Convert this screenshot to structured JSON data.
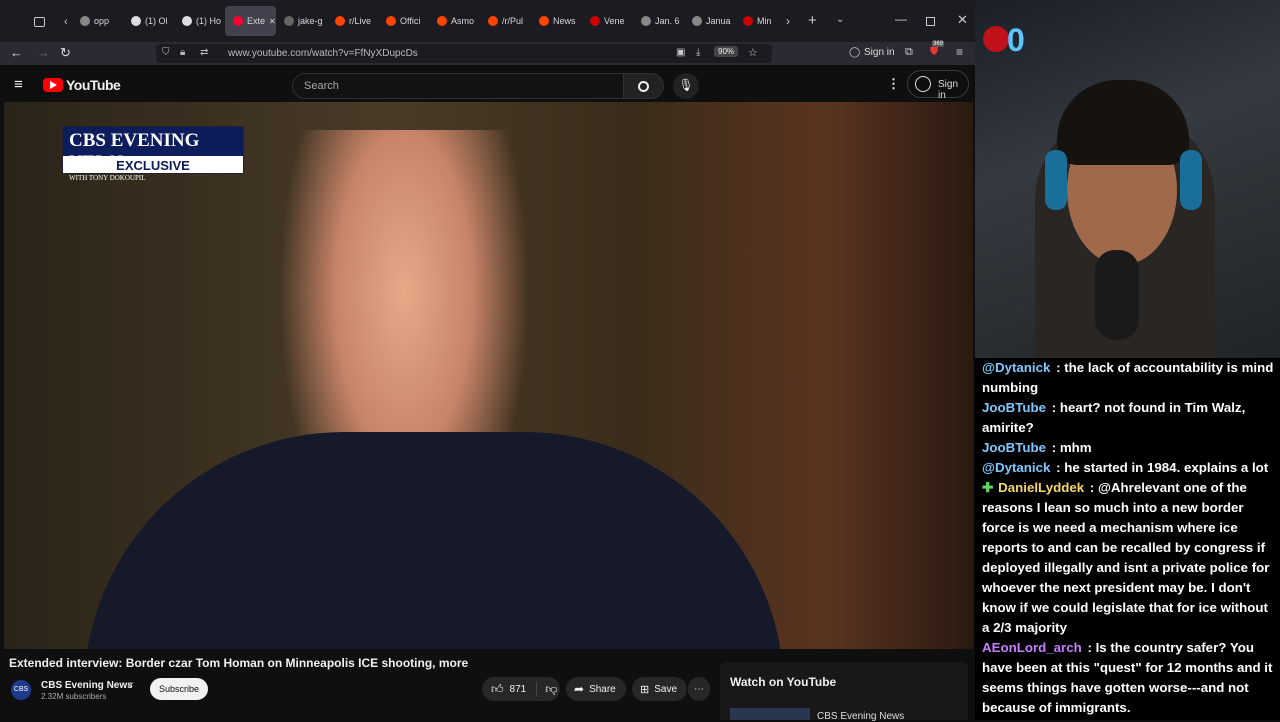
{
  "browser": {
    "tabs": [
      {
        "label": "opp",
        "color": "#888"
      },
      {
        "label": "(1) Ol",
        "color": "#ddd"
      },
      {
        "label": "(1) Ho",
        "color": "#ddd"
      },
      {
        "label": "Exte",
        "color": "#ff0033",
        "active": true
      },
      {
        "label": "jake-g",
        "color": "#666"
      },
      {
        "label": "r/Live",
        "color": "#ff4500"
      },
      {
        "label": "Offici",
        "color": "#ff4500"
      },
      {
        "label": "Asmo",
        "color": "#ff4500"
      },
      {
        "label": "/r/Pul",
        "color": "#ff4500"
      },
      {
        "label": "News",
        "color": "#ff4500"
      },
      {
        "label": "Vene",
        "color": "#c00"
      },
      {
        "label": "Jan. 6",
        "color": "#888"
      },
      {
        "label": "Janua",
        "color": "#888"
      },
      {
        "label": "Min",
        "color": "#c00"
      }
    ],
    "url": "www.youtube.com/watch?v=FfNyXDupcDs",
    "zoom": "90%",
    "sign_in": "Sign in",
    "badge": "369"
  },
  "youtube": {
    "brand": "YouTube",
    "search_placeholder": "Search",
    "sign_in": "Sign in",
    "video_logo_line1": "CBS EVENING NEWS",
    "video_logo_line2": "WITH TONY DOKOUPIL",
    "video_logo_line3": "EXCLUSIVE",
    "title": "Extended interview: Border czar Tom Homan on Minneapolis ICE shooting, more",
    "channel": "CBS Evening News",
    "subscribers": "2.32M subscribers",
    "subscribe": "Subscribe",
    "likes": "871",
    "share": "Share",
    "save": "Save",
    "watch_on": "Watch on YouTube",
    "watch_channel": "CBS Evening News"
  },
  "stream": {
    "overlay_digit": "0"
  },
  "chat": [
    {
      "user": "@Dytanick",
      "color": "#7ec8ff",
      "text": "the lack of accountability is mind numbing"
    },
    {
      "user": "JooBTube",
      "color": "#7ec8ff",
      "text": "heart? not found in Tim Walz, amirite?"
    },
    {
      "user": "JooBTube",
      "color": "#7ec8ff",
      "text": "mhm"
    },
    {
      "user": "@Dytanick",
      "color": "#7ec8ff",
      "text": "he started in 1984. explains a lot"
    },
    {
      "user": "DanielLyddek",
      "color": "#f5d76e",
      "badge": "✚",
      "text": "@Ahrelevant one of the reasons I lean so much into a new border force is we need a mechanism where ice reports to and can be recalled by congress if deployed illegally and isnt a private police for whoever the next president may be. I don't know if we could legislate that for ice without a 2/3 majority"
    },
    {
      "user": "AEonLord_arch",
      "color": "#c77dff",
      "text": "Is the country safer? You have been at this \"quest\" for 12 months and it seems things have gotten worse---and not because of immigrants."
    }
  ]
}
